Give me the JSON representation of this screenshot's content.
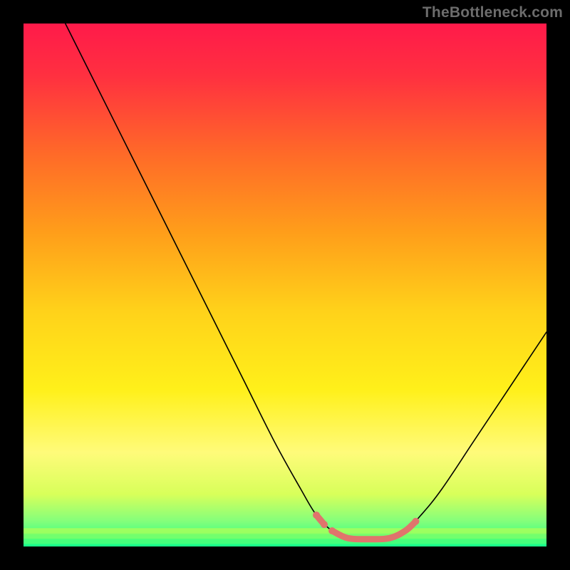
{
  "attribution": "TheBottleneck.com",
  "chart_data": {
    "type": "line",
    "title": "",
    "xlabel": "",
    "ylabel": "",
    "xlim": [
      0,
      100
    ],
    "ylim": [
      0,
      100
    ],
    "background_gradient": {
      "stops": [
        {
          "offset": 0.0,
          "color": "#ff1a4a"
        },
        {
          "offset": 0.1,
          "color": "#ff3040"
        },
        {
          "offset": 0.25,
          "color": "#ff6a28"
        },
        {
          "offset": 0.4,
          "color": "#ff9e1a"
        },
        {
          "offset": 0.55,
          "color": "#ffd21a"
        },
        {
          "offset": 0.7,
          "color": "#fff01a"
        },
        {
          "offset": 0.82,
          "color": "#fffb7a"
        },
        {
          "offset": 0.9,
          "color": "#d8ff5a"
        },
        {
          "offset": 0.95,
          "color": "#86ff7a"
        },
        {
          "offset": 1.0,
          "color": "#1aff8a"
        }
      ],
      "green_bands": [
        {
          "y": 0.965,
          "color": "#a8ff5a"
        },
        {
          "y": 0.975,
          "color": "#7aff6a"
        },
        {
          "y": 0.985,
          "color": "#4aff7a"
        },
        {
          "y": 0.995,
          "color": "#1aff8a"
        }
      ]
    },
    "curve": [
      {
        "x": 8.0,
        "y": 100.0
      },
      {
        "x": 12.0,
        "y": 92.0
      },
      {
        "x": 18.0,
        "y": 80.0
      },
      {
        "x": 24.0,
        "y": 68.0
      },
      {
        "x": 30.0,
        "y": 56.0
      },
      {
        "x": 36.0,
        "y": 44.0
      },
      {
        "x": 42.0,
        "y": 32.0
      },
      {
        "x": 48.0,
        "y": 20.0
      },
      {
        "x": 53.0,
        "y": 11.0
      },
      {
        "x": 56.0,
        "y": 6.0
      },
      {
        "x": 59.0,
        "y": 3.0
      },
      {
        "x": 62.0,
        "y": 1.6
      },
      {
        "x": 66.0,
        "y": 1.4
      },
      {
        "x": 70.0,
        "y": 1.6
      },
      {
        "x": 73.0,
        "y": 3.0
      },
      {
        "x": 76.0,
        "y": 6.0
      },
      {
        "x": 80.0,
        "y": 11.0
      },
      {
        "x": 86.0,
        "y": 20.0
      },
      {
        "x": 92.0,
        "y": 29.0
      },
      {
        "x": 100.0,
        "y": 41.0
      }
    ],
    "highlight": {
      "color": "#e0746c",
      "segments": [
        [
          {
            "x": 56.0,
            "y": 6.0
          },
          {
            "x": 57.5,
            "y": 4.2
          }
        ],
        [
          {
            "x": 59.0,
            "y": 3.0
          },
          {
            "x": 62.0,
            "y": 1.6
          },
          {
            "x": 66.0,
            "y": 1.4
          },
          {
            "x": 70.0,
            "y": 1.6
          },
          {
            "x": 73.0,
            "y": 3.0
          },
          {
            "x": 75.0,
            "y": 4.8
          }
        ]
      ],
      "line_width": 9,
      "dot_radius": 5
    }
  }
}
